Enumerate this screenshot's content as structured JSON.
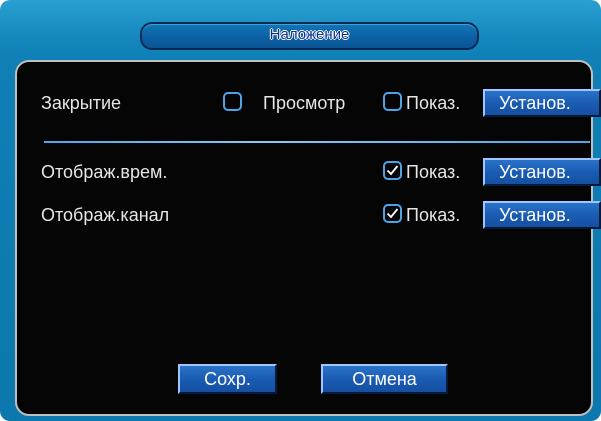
{
  "dialog": {
    "title": "Наложение"
  },
  "rows": [
    {
      "label": "Закрытие",
      "preview_label": "Просмотр",
      "preview_checked": false,
      "show_label": "Показ.",
      "show_checked": false,
      "set_label": "Установ."
    },
    {
      "label": "Отображ.врем.",
      "show_label": "Показ.",
      "show_checked": true,
      "set_label": "Установ."
    },
    {
      "label": "Отображ.канал",
      "show_label": "Показ.",
      "show_checked": true,
      "set_label": "Установ."
    }
  ],
  "footer": {
    "save_label": "Сохр.",
    "cancel_label": "Отмена"
  },
  "colors": {
    "accent": "#4aa6e8",
    "frame": "#1387bd",
    "button": "#1a5cb3",
    "panel": "#050505"
  }
}
